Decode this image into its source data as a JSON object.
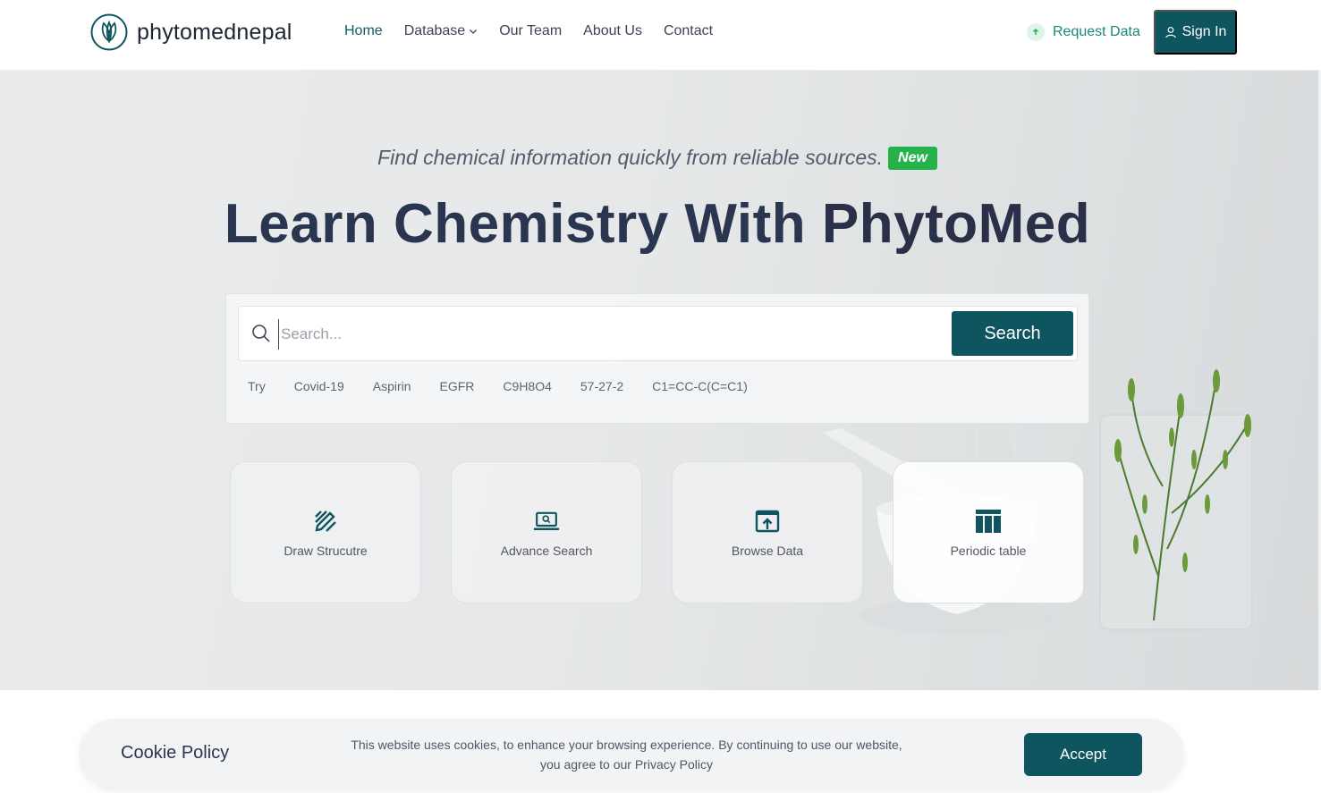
{
  "header": {
    "logo_text": "phytomednepal",
    "nav": [
      {
        "label": "Home",
        "active": true
      },
      {
        "label": "Database",
        "has_dropdown": true
      },
      {
        "label": "Our Team"
      },
      {
        "label": "About Us"
      },
      {
        "label": "Contact"
      }
    ],
    "request_data_label": "Request Data",
    "sign_in_label": "Sign In"
  },
  "hero": {
    "tagline": "Find chemical information quickly from reliable sources.",
    "badge": "New",
    "headline_prefix": "Learn Chemistry With",
    "headline_bold": "PhytoMed"
  },
  "search": {
    "placeholder": "Search...",
    "value": "",
    "button_label": "Search",
    "try_label": "Try",
    "suggestions": [
      "Covid-19",
      "Aspirin",
      "EGFR",
      "C9H8O4",
      "57-27-2",
      "C1=CC-C(C=C1)"
    ]
  },
  "cards": [
    {
      "label": "Draw Strucutre",
      "icon": "draw-structure-icon"
    },
    {
      "label": "Advance Search",
      "icon": "laptop-search-icon"
    },
    {
      "label": "Browse Data",
      "icon": "browse-upload-icon"
    },
    {
      "label": "Periodic table",
      "icon": "table-icon"
    }
  ],
  "cookie": {
    "title": "Cookie Policy",
    "text": "This website uses cookies, to enhance your browsing experience. By continuing to use our website, you agree to our Privacy Policy",
    "accept_label": "Accept"
  },
  "colors": {
    "brand": "#0e5560",
    "badge_green": "#26b24b",
    "accent_text": "#178a78",
    "headline": "#2a3550"
  }
}
